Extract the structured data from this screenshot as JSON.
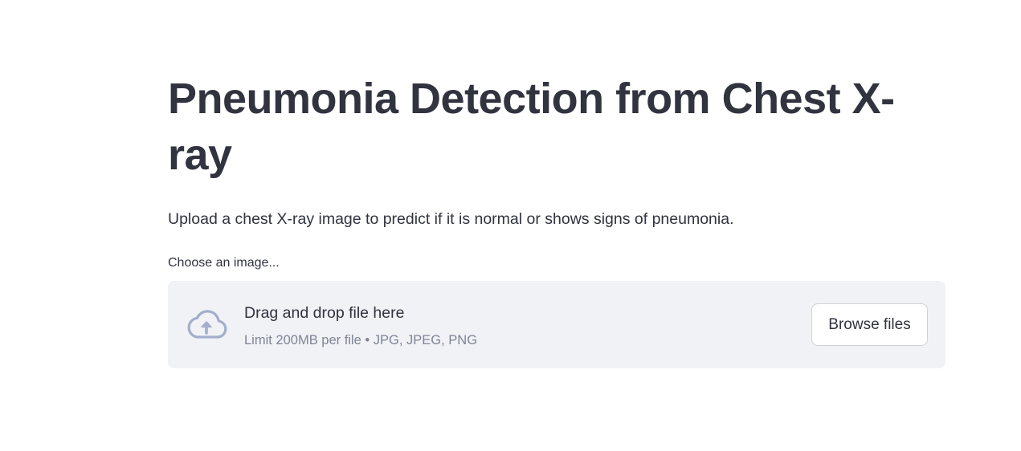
{
  "header": {
    "title": "Pneumonia Detection from Chest X-ray",
    "description": "Upload a chest X-ray image to predict if it is normal or shows signs of pneumonia."
  },
  "uploader": {
    "label": "Choose an image...",
    "drop_text": "Drag and drop file here",
    "limit_text": "Limit 200MB per file • JPG, JPEG, PNG",
    "browse_label": "Browse files",
    "icon": "cloud-upload-icon"
  },
  "colors": {
    "text": "#31333f",
    "muted_text": "#808495",
    "dropzone_bg": "#f0f2f6",
    "icon": "#a3aecb"
  }
}
